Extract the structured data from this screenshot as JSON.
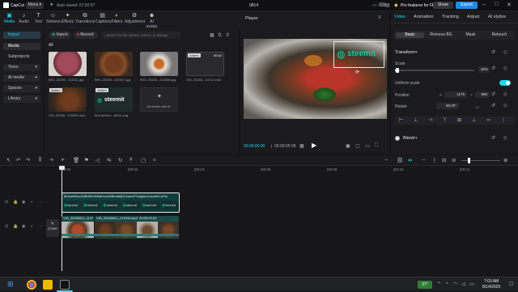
{
  "titlebar": {
    "app_name": "CapCut",
    "menu_label": "Menu",
    "autosave": "Auto saved: 07:02:57",
    "project_name": "0814",
    "pro_label": "Pro features for FREE",
    "share_label": "Share",
    "export_label": "Export"
  },
  "top_tabs": [
    {
      "label": "Media",
      "icon": "media-icon",
      "active": true
    },
    {
      "label": "Audio",
      "icon": "audio-icon"
    },
    {
      "label": "Text",
      "icon": "text-icon"
    },
    {
      "label": "Stickers",
      "icon": "sticker-icon"
    },
    {
      "label": "Effects",
      "icon": "effects-icon"
    },
    {
      "label": "Transitions",
      "icon": "transitions-icon"
    },
    {
      "label": "Captions",
      "icon": "captions-icon"
    },
    {
      "label": "Filters",
      "icon": "filters-icon"
    },
    {
      "label": "Adjustment",
      "icon": "adjustment-icon"
    },
    {
      "label": "AI avatar",
      "icon": "ai-avatar-icon"
    }
  ],
  "leftnav": {
    "items": [
      "Import",
      "Media",
      "Subprojects",
      "Yours",
      "AI media",
      "Spaces",
      "Library"
    ]
  },
  "media": {
    "import_label": "Import",
    "record_label": "Record",
    "search_placeholder": "Search for file names, scenes, or dialogs",
    "all_label": "All",
    "items": [
      {
        "caption": "IMG_20250...111511.jpg",
        "badge": ""
      },
      {
        "caption": "IMG_20250...222347.jpg",
        "badge": ""
      },
      {
        "caption": "IMG_20250...222358.jpg",
        "badge": ""
      },
      {
        "caption": "VID_20250...14711.mp4",
        "badge": "Added",
        "duration": "00:02"
      },
      {
        "caption": "VID_20250...215009.mp4",
        "badge": "Added"
      },
      {
        "caption": "8rVcaHSoo...8hUe.png",
        "badge": "Added"
      },
      {
        "caption": "Generate with AI",
        "badge": ""
      }
    ],
    "steemit_text": "steemit"
  },
  "player": {
    "title": "Player",
    "time_current": "00:00:00:00",
    "time_total": "00:00:05:08",
    "overlay_text": "steemit"
  },
  "props": {
    "tabs": [
      "Video",
      "Animation",
      "Tracking",
      "Adjust",
      "AI stylize"
    ],
    "subtabs": [
      "Basic",
      "Remove BG",
      "Mask",
      "Retouch"
    ],
    "transform_label": "Transform",
    "scale_label": "Scale",
    "scale_value": "35%",
    "scale_level": 0.35,
    "uniform_label": "Uniform scale",
    "position_label": "Position",
    "pos_x_label": "X",
    "pos_x": "1175",
    "pos_y_label": "Y",
    "pos_y": "659",
    "rotate_label": "Rotate",
    "rotate_value": "90.00°",
    "blend_label": "Blend"
  },
  "timeline": {
    "ruler": [
      "00:00",
      "|00:02",
      "|00:04",
      "|00:06",
      "|00:08",
      "|00:10",
      "|00:12",
      "|00:14"
    ],
    "overlay_clip_name": "8rVcaHSoo2QBHNhVeNdDvveMBmdd5jTu1smdTVwgbuJnvxxNKCnFtu",
    "clip1_name": "VID_20250811_1147",
    "clip2_name": "VID_20250811_121009.mp4",
    "clip2_duration": "00:00:03:24",
    "cover_label": "Cover"
  },
  "taskbar": {
    "temp": "27°",
    "time": "7:03 AM",
    "date": "8/14/2025"
  }
}
